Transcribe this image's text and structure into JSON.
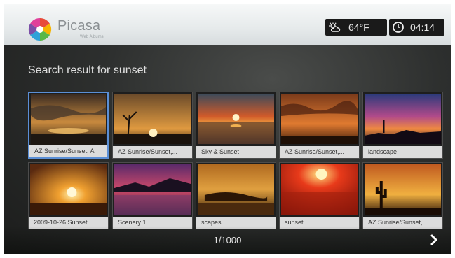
{
  "app": {
    "name": "Picasa",
    "subtitle": "Web Albums"
  },
  "status": {
    "temperature": "64°F",
    "time": "04:14",
    "weather_icon": "cloud-sun-icon",
    "clock_icon": "clock-icon"
  },
  "search": {
    "title": "Search result for sunset"
  },
  "results": [
    {
      "caption": "AZ Sunrise/Sunset, A",
      "selected": true
    },
    {
      "caption": "AZ Sunrise/Sunset,..."
    },
    {
      "caption": "Sky & Sunset"
    },
    {
      "caption": "AZ Sunrise/Sunset,..."
    },
    {
      "caption": "landscape"
    },
    {
      "caption": "2009-10-26 Sunset ..."
    },
    {
      "caption": "Scenery 1"
    },
    {
      "caption": "scapes"
    },
    {
      "caption": "sunset"
    },
    {
      "caption": "AZ Sunrise/Sunset,..."
    }
  ],
  "pager": {
    "label": "1/1000",
    "next_icon": "chevron-right-icon"
  }
}
